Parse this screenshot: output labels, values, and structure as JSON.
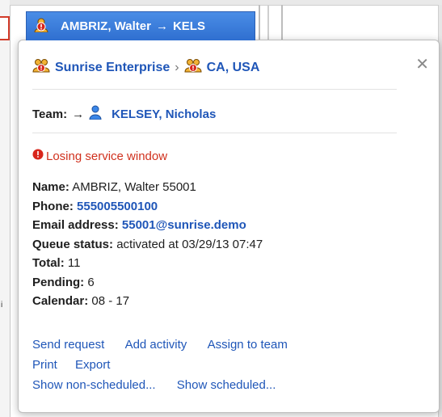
{
  "chip": {
    "text": "AMBRIZ, Walter",
    "arrow": "→",
    "target": "KELS",
    "icon": "alert-person-icon"
  },
  "card": {
    "close": "✕",
    "location": {
      "enterprise": "Sunrise Enterprise",
      "separator": "›",
      "region": "CA, USA",
      "icon": "group-people-icon"
    },
    "team": {
      "label": "Team:",
      "arrow": "→",
      "name": "KELSEY, Nicholas",
      "icon": "person-icon"
    },
    "warning": {
      "text": "Losing service window",
      "color": "#d0311e",
      "icon": "alert-circle-icon"
    },
    "details": {
      "name_label": "Name:",
      "name_value": "AMBRIZ, Walter 55001",
      "phone_label": "Phone:",
      "phone_value": "555005500100",
      "email_label": "Email address:",
      "email_value": "55001@sunrise.demo",
      "queue_label": "Queue status:",
      "queue_value": "activated at 03/29/13 07:47",
      "total_label": "Total:",
      "total_value": "11",
      "pending_label": "Pending:",
      "pending_value": "6",
      "calendar_label": "Calendar:",
      "calendar_value": "08 - 17"
    },
    "actions": {
      "send_request": "Send request",
      "add_activity": "Add activity",
      "assign_to_team": "Assign to team",
      "print": "Print",
      "export": "Export",
      "show_non_scheduled": "Show non-scheduled...",
      "show_scheduled": "Show scheduled..."
    }
  },
  "colors": {
    "link": "#1f56b8",
    "chip_bg": "#3a7ddc",
    "warning": "#d0311e"
  }
}
